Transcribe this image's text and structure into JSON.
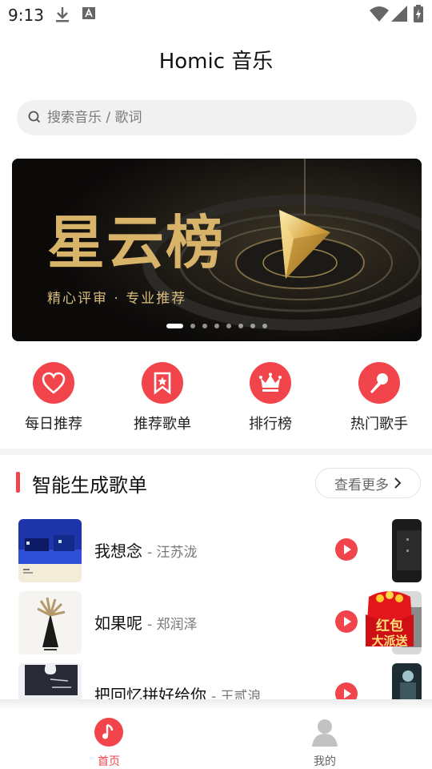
{
  "status_bar": {
    "time": "9:13",
    "left_icons": [
      "download-icon",
      "a-icon"
    ],
    "right_icons": [
      "wifi-icon",
      "signal-icon",
      "battery-icon"
    ]
  },
  "app_title": "Homic 音乐",
  "search": {
    "placeholder": "搜索音乐 / 歌词",
    "icon": "search-icon"
  },
  "banner": {
    "title": "星云榜",
    "subtitle": "精心评审 · 专业推荐",
    "slide_count": 8,
    "active_slide": 1
  },
  "quick_actions": [
    {
      "label": "每日推荐",
      "icon": "heart-icon"
    },
    {
      "label": "推荐歌单",
      "icon": "bookmark-star-icon"
    },
    {
      "label": "排行榜",
      "icon": "crown-icon"
    },
    {
      "label": "热门歌手",
      "icon": "microphone-icon"
    }
  ],
  "section": {
    "title": "智能生成歌单",
    "more_label": "查看更多"
  },
  "songs": [
    {
      "title": "我想念",
      "artist": "- 汪苏泷"
    },
    {
      "title": "如果呢",
      "artist": "- 郑润泽"
    },
    {
      "title": "把回忆拼好给你",
      "artist": "- 王贰浪"
    }
  ],
  "red_envelope": {
    "line1": "红包",
    "line2": "大派送"
  },
  "tabs": [
    {
      "label": "首页",
      "icon": "music-note-icon",
      "active": true
    },
    {
      "label": "我的",
      "icon": "user-icon",
      "active": false
    }
  ],
  "colors": {
    "accent": "#f2454b",
    "banner_gold": "#d8b46a",
    "search_bg": "#f1f1f1"
  }
}
